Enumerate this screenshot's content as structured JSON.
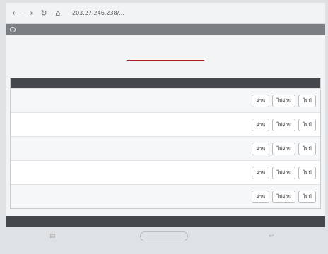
{
  "browser": {
    "url": "203.27.246.238/...",
    "back_icon": "arrow-left-icon",
    "forward_icon": "arrow-right-icon",
    "reload_icon": "reload-icon",
    "home_icon": "home-icon"
  },
  "appbar": {
    "title": ""
  },
  "page": {
    "title": "",
    "subtitle": ""
  },
  "table": {
    "header_left": "",
    "header_right": "",
    "rows": [
      {
        "lines": [
          "",
          ""
        ],
        "buttons": [
          "ผ่าน",
          "ไม่ผ่าน",
          "ไม่มี"
        ]
      },
      {
        "lines": [
          ""
        ],
        "buttons": [
          "ผ่าน",
          "ไม่ผ่าน",
          "ไม่มี"
        ]
      },
      {
        "lines": [
          "",
          ""
        ],
        "buttons": [
          "ผ่าน",
          "ไม่ผ่าน",
          "ไม่มี"
        ]
      },
      {
        "lines": [
          "",
          ""
        ],
        "buttons": [
          "ผ่าน",
          "ไม่ผ่าน",
          "ไม่มี"
        ]
      },
      {
        "lines": [
          "",
          ""
        ],
        "buttons": [
          "ผ่าน",
          "ไม่ผ่าน",
          "ไม่มี"
        ]
      }
    ]
  },
  "footer": {
    "text": ""
  },
  "colors": {
    "title": "#b22222",
    "text": "#1f3b73",
    "appbar": "#7b7f84",
    "table_head": "#44484d"
  }
}
